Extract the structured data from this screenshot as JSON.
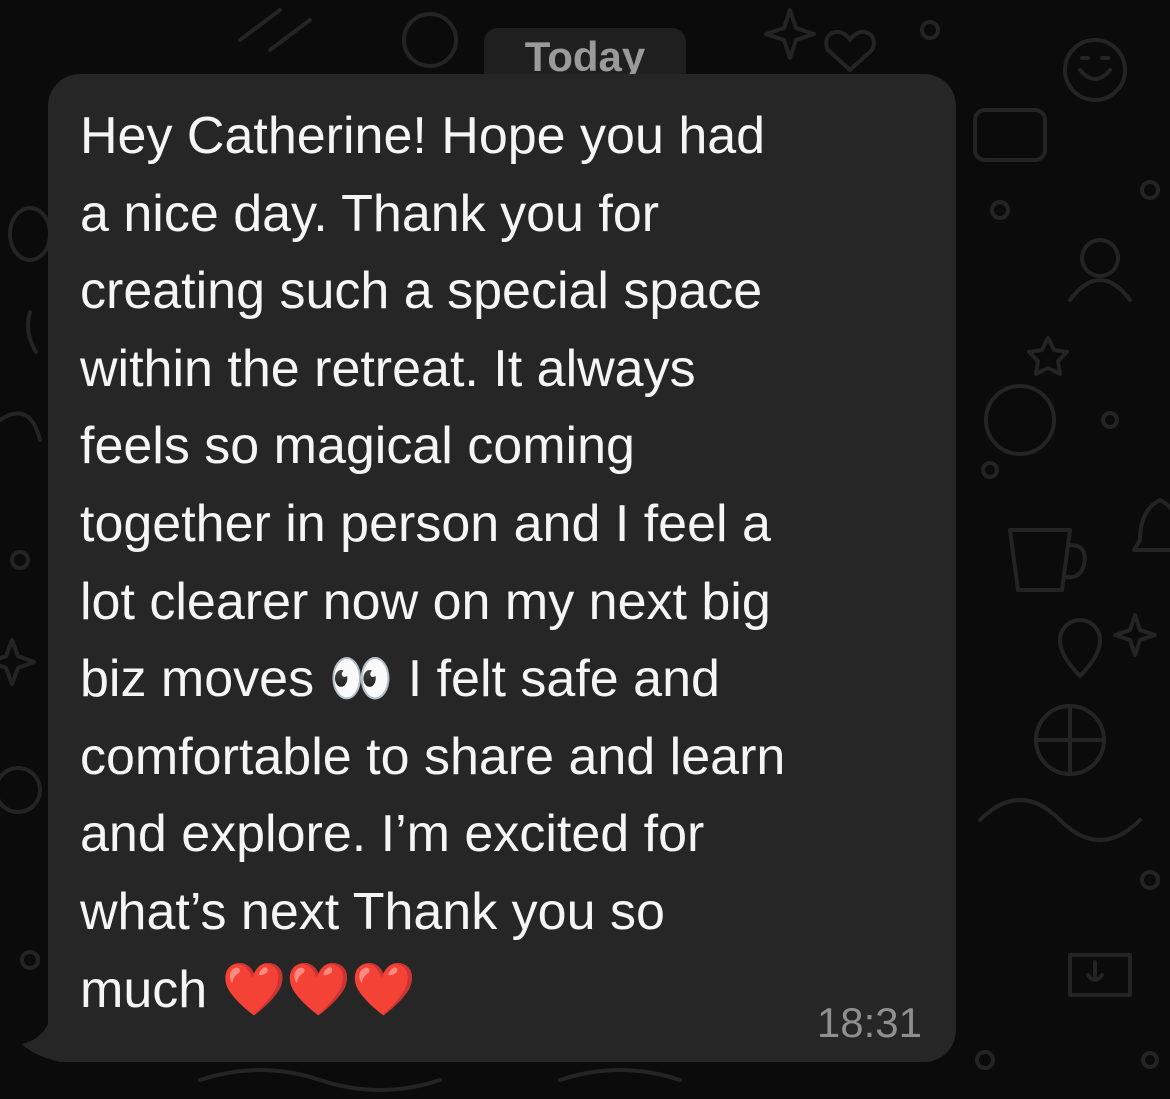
{
  "chat": {
    "date_separator": "Today",
    "message": {
      "text": "Hey Catherine! Hope you had\na nice day. Thank you for\ncreating such a special space\nwithin the retreat. It always\nfeels so magical coming\ntogether in person and I feel a\nlot clearer now on my next big\nbiz moves 👀 I felt safe and\ncomfortable to share and learn\nand explore. I’m excited for\nwhat’s next Thank you so\nmuch ❤️❤️❤️",
      "time": "18:31",
      "direction": "incoming"
    }
  },
  "colors": {
    "background": "#0b0b0b",
    "bubble": "#262626",
    "text": "#f5f5f5",
    "time": "#8f8f8f",
    "date_pill": "#1f1f1f",
    "wallpaper_doodle": "#242424"
  },
  "icons": [
    "heart-icon",
    "star-icon",
    "smiley-icon",
    "balloon-icon",
    "person-icon",
    "bell-icon",
    "cup-icon",
    "location-pin-icon",
    "basketball-icon",
    "microphone-icon",
    "sparkle-icon"
  ]
}
